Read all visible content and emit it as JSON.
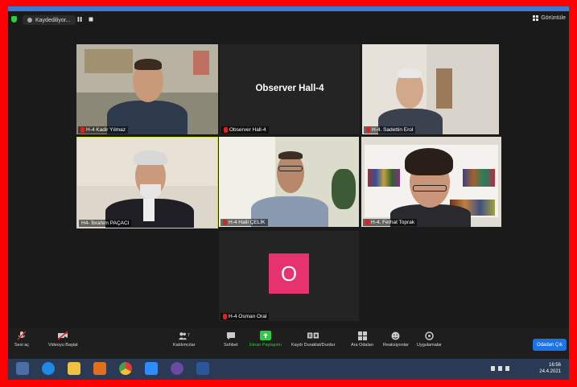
{
  "topbar": {
    "recording_label": "Kaydediliyor...",
    "view_label": "Görüntüle"
  },
  "participants": [
    {
      "name": "H-4 Kadir Yılmaz"
    },
    {
      "name": "Observer Hall-4",
      "display_text": "Observer Hall-4"
    },
    {
      "name": "H-4. Sadettin Erol"
    },
    {
      "name": "H4- İbrahim PAÇACI"
    },
    {
      "name": "H-4 Halil ÇELİK"
    },
    {
      "name": "H-4. Ferhat Toprak"
    },
    {
      "name": "H-4 Osman Oral",
      "avatar_letter": "O",
      "avatar_color": "#e6326e"
    }
  ],
  "toolbar": {
    "unmute": "Sesi aç",
    "start_video": "Videoyu Başlat",
    "participants": "Katılımcılar",
    "participants_count": "7",
    "chat": "Sohbet",
    "share_screen": "Ekran Paylaşımı",
    "pause_recording": "Kaydı Duraklat/Durdur",
    "breakout_rooms": "Ara Odaları",
    "reactions": "Reaksiyonlar",
    "apps": "Uygulamalar",
    "leave_room": "Odadan Çık"
  },
  "taskbar": {
    "time": "16:56",
    "date": "24.4.2021"
  },
  "colors": {
    "border": "#ff0000",
    "share_green": "#2ecc40",
    "leave_blue": "#1a73e8",
    "active_speaker": "#d4e04a"
  }
}
